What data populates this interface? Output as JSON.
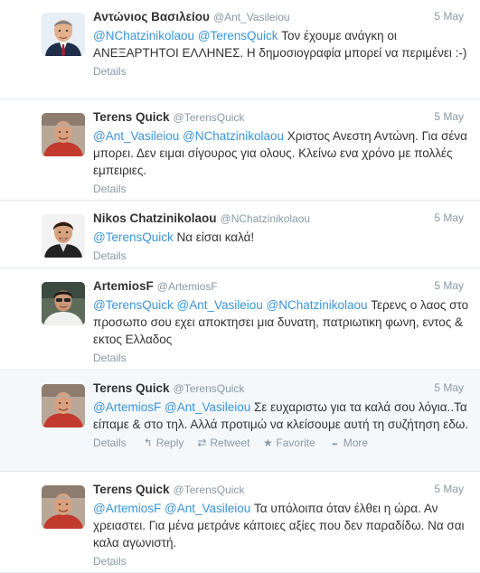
{
  "tweets": [
    {
      "name": "Αντώνιος Βασιλείου",
      "handle": "@Ant_Vasileiou",
      "time": "5 May",
      "segments": [
        {
          "t": "mention",
          "v": "@NChatzinikolaou"
        },
        {
          "t": "text",
          "v": " "
        },
        {
          "t": "mention",
          "v": "@TerensQuick"
        },
        {
          "t": "text",
          "v": " Τον έχουμε ανάγκη οι ΑΝΕΞΑΡΤΗΤΟΙ ΕΛΛΗΝΕΣ. Η δημοσιογραφία μπορεί να περιμένει :-)"
        }
      ],
      "details": "Details",
      "avatar": "avatar-antonios"
    },
    {
      "name": "Terens Quick",
      "handle": "@TerensQuick",
      "time": "5 May",
      "segments": [
        {
          "t": "mention",
          "v": "@Ant_Vasileiou"
        },
        {
          "t": "text",
          "v": " "
        },
        {
          "t": "mention",
          "v": "@NChatzinikolaou"
        },
        {
          "t": "text",
          "v": " Χριστος Ανεστη Αντώνη. Για σένα μπορει. Δεν ειμαι σίγουρος για ολους. Κλείνω ενα χρόνο με πολλές εμπειριες."
        }
      ],
      "details": "Details",
      "avatar": "avatar-terens"
    },
    {
      "name": "Nikos Chatzinikolaou",
      "handle": "@NChatzinikolaou",
      "time": "5 May",
      "segments": [
        {
          "t": "mention",
          "v": "@TerensQuick"
        },
        {
          "t": "text",
          "v": " Να είσαι καλά!"
        }
      ],
      "details": "Details",
      "avatar": "avatar-nikos"
    },
    {
      "name": "ArtemiosF",
      "handle": "@ArtemiosF",
      "time": "5 May",
      "segments": [
        {
          "t": "mention",
          "v": "@TerensQuick"
        },
        {
          "t": "text",
          "v": " "
        },
        {
          "t": "mention",
          "v": "@Ant_Vasileiou"
        },
        {
          "t": "text",
          "v": " "
        },
        {
          "t": "mention",
          "v": "@NChatzinikolaou"
        },
        {
          "t": "text",
          "v": " Τερενς ο λαος στο προσωπο σου εχει αποκτησει μια δυνατη, πατριωτικη φωνη, εντος & εκτος Ελλαδος"
        }
      ],
      "details": "Details",
      "avatar": "avatar-artemios"
    },
    {
      "name": "Terens Quick",
      "handle": "@TerensQuick",
      "time": "5 May",
      "segments": [
        {
          "t": "mention",
          "v": "@ArtemiosF"
        },
        {
          "t": "text",
          "v": " "
        },
        {
          "t": "mention",
          "v": "@Ant_Vasileiou"
        },
        {
          "t": "text",
          "v": " Σε ευχαριστω για τα καλά σου λόγια..Τα είπαμε & στο τηλ. Αλλά προτιμώ να κλείσουμε αυτή τη συζήτηση εδω."
        }
      ],
      "details": "Details",
      "avatar": "avatar-terens",
      "hovered": true,
      "actions": [
        {
          "name": "reply",
          "icon": "reply-icon",
          "glyph": "↰",
          "label": "Reply"
        },
        {
          "name": "retweet",
          "icon": "retweet-icon",
          "glyph": "⇄",
          "label": "Retweet"
        },
        {
          "name": "favorite",
          "icon": "star-icon",
          "glyph": "★",
          "label": "Favorite"
        },
        {
          "name": "more",
          "icon": "more-icon",
          "glyph": "•••",
          "label": "More"
        }
      ]
    },
    {
      "name": "Terens Quick",
      "handle": "@TerensQuick",
      "time": "5 May",
      "segments": [
        {
          "t": "mention",
          "v": "@ArtemiosF"
        },
        {
          "t": "text",
          "v": " "
        },
        {
          "t": "mention",
          "v": "@Ant_Vasileiou"
        },
        {
          "t": "text",
          "v": " Τα υπόλοιπα όταν έλθει η ώρα. Αν χρειαστει. Για μένα μετράνε κάποιες αξίες που δεν παραδίδω. Να σαι καλα αγωνιστή."
        }
      ],
      "details": "Details",
      "avatar": "avatar-terens"
    }
  ]
}
